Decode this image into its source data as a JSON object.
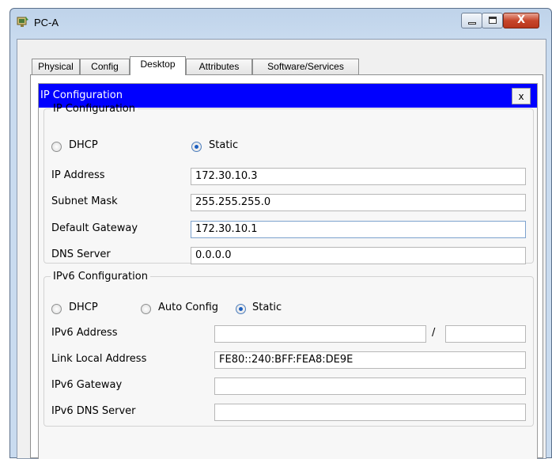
{
  "window": {
    "title": "PC-A",
    "close_glyph": "X"
  },
  "tabs": [
    "Physical",
    "Config",
    "Desktop",
    "Attributes",
    "Software/Services"
  ],
  "active_tab": "Desktop",
  "dialog": {
    "title": "IP Configuration",
    "close_label": "x"
  },
  "ipv4": {
    "legend": "IP Configuration",
    "dhcp_label": "DHCP",
    "static_label": "Static",
    "selected_mode": "Static",
    "ip_label": "IP Address",
    "ip_value": "172.30.10.3",
    "mask_label": "Subnet Mask",
    "mask_value": "255.255.255.0",
    "gateway_label": "Default Gateway",
    "gateway_value": "172.30.10.1",
    "dns_label": "DNS Server",
    "dns_value": "0.0.0.0"
  },
  "ipv6": {
    "legend": "IPv6 Configuration",
    "dhcp_label": "DHCP",
    "auto_label": "Auto Config",
    "static_label": "Static",
    "selected_mode": "Static",
    "address_label": "IPv6 Address",
    "address_value": "",
    "prefix_separator": "/",
    "prefix_value": "",
    "link_local_label": "Link Local Address",
    "link_local_value": "FE80::240:BFF:FEA8:DE9E",
    "gateway_label": "IPv6 Gateway",
    "gateway_value": "",
    "dns_label": "IPv6 DNS Server",
    "dns_value": ""
  },
  "colors": {
    "dialog_header": "#0000ff",
    "close_button": "#c7462b"
  }
}
